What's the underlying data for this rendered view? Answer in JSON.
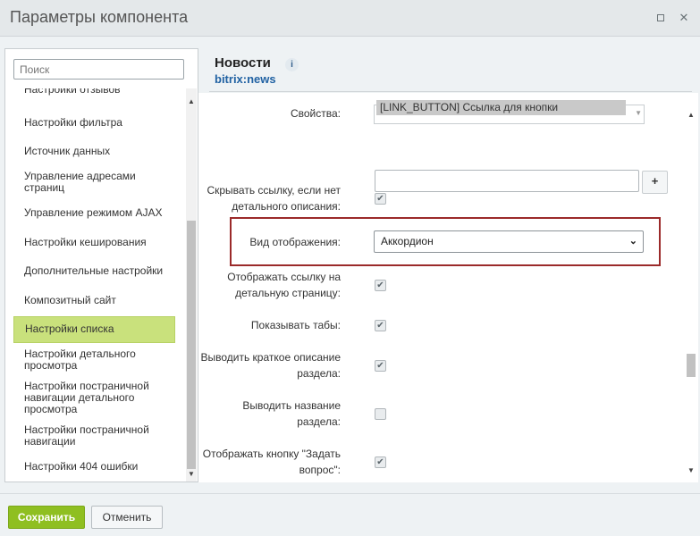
{
  "window": {
    "title": "Параметры компонента",
    "maximize_icon": "maximize-icon",
    "close_icon": "close-icon",
    "close_glyph": "✕"
  },
  "sidebar": {
    "search_placeholder": "Поиск",
    "items": [
      {
        "label": "Настройки отзывов",
        "active": false
      },
      {
        "label": "Настройки фильтра",
        "active": false
      },
      {
        "label": "Источник данных",
        "active": false
      },
      {
        "label": "Управление адресами страниц",
        "active": false
      },
      {
        "label": "Управление режимом AJAX",
        "active": false
      },
      {
        "label": "Настройки кеширования",
        "active": false
      },
      {
        "label": "Дополнительные настройки",
        "active": false
      },
      {
        "label": "Композитный сайт",
        "active": false
      },
      {
        "label": "Настройки списка",
        "active": true
      },
      {
        "label": "Настройки детального просмотра",
        "active": false
      },
      {
        "label": "Настройки постраничной навигации детального просмотра",
        "active": false
      },
      {
        "label": "Настройки постраничной навигации",
        "active": false
      },
      {
        "label": "Настройки 404 ошибки",
        "active": false
      }
    ]
  },
  "component": {
    "title": "Новости",
    "code": "bitrix:news",
    "info_glyph": "i"
  },
  "form": {
    "properties_label": "Свойства:",
    "properties_selected": "[LINK_BUTTON] Ссылка для кнопки",
    "add_button": "+",
    "hide_link_label": "Скрывать ссылку, если нет детального описания:",
    "hide_link_checked": true,
    "view_mode_label": "Вид отображения:",
    "view_mode_value": "Аккордион",
    "show_detail_link_label": "Отображать ссылку на детальную страницу:",
    "show_detail_link_checked": true,
    "show_tabs_label": "Показывать табы:",
    "show_tabs_checked": true,
    "show_section_desc_label": "Выводить краткое описание раздела:",
    "show_section_desc_checked": true,
    "show_section_name_label": "Выводить название раздела:",
    "show_section_name_checked": false,
    "show_ask_button_label": "Отображать кнопку \"Задать вопрос\":",
    "show_ask_button_checked": true,
    "check_glyph": "✔"
  },
  "footer": {
    "save_label": "Сохранить",
    "cancel_label": "Отменить"
  }
}
